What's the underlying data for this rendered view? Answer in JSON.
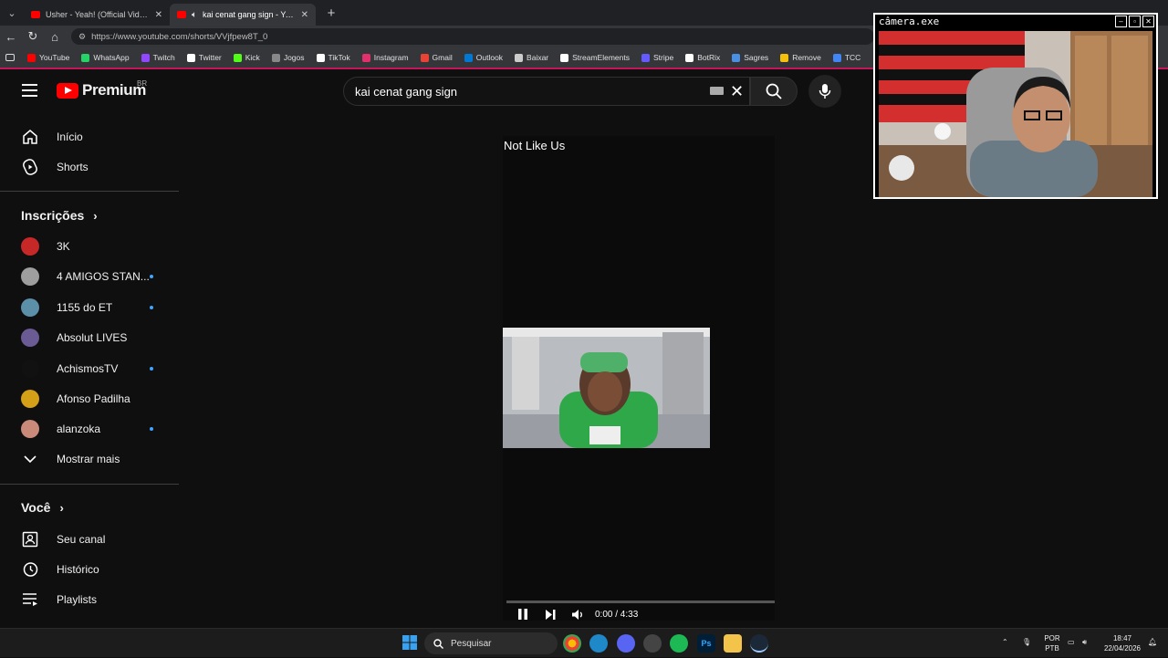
{
  "browser": {
    "tabs": [
      {
        "title": "Usher - Yeah! (Official Video) ft. Lil",
        "active": false
      },
      {
        "title": "kai cenat gang sign - YouTube",
        "active": true
      }
    ],
    "new_tab": "+",
    "url": "https://www.youtube.com/shorts/VVjfpew8T_0",
    "bookmarks": [
      "YouTube",
      "WhatsApp",
      "Twitch",
      "Twitter",
      "Kick",
      "Jogos",
      "TikTok",
      "Instagram",
      "Gmail",
      "Outlook",
      "Baixar",
      "StreamElements",
      "Stripe",
      "BotRix",
      "Sagres",
      "Remove",
      "TCC"
    ],
    "bookmark_colors": [
      "#ff0000",
      "#25d366",
      "#9146ff",
      "#ffffff",
      "#53fc18",
      "#888888",
      "#ffffff",
      "#e1306c",
      "#ea4335",
      "#0078d4",
      "#cccccc",
      "#ffffff",
      "#635bff",
      "#ffffff",
      "#4a90e2",
      "#f4c20d",
      "#4285f4"
    ]
  },
  "youtube": {
    "logo": "Premium",
    "logo_region": "BR",
    "search": {
      "value": "kai cenat gang sign"
    },
    "sidebar": {
      "main": [
        {
          "label": "Início",
          "icon": "home-icon"
        },
        {
          "label": "Shorts",
          "icon": "shorts-icon"
        }
      ],
      "subscriptions_header": "Inscrições",
      "subscriptions": [
        {
          "label": "3K",
          "dot": false,
          "color": "#c62828"
        },
        {
          "label": "4 AMIGOS STAN...",
          "dot": true,
          "color": "#9e9e9e"
        },
        {
          "label": "1155 do ET",
          "dot": true,
          "color": "#5c8fa8"
        },
        {
          "label": "Absolut LIVES",
          "dot": false,
          "color": "#6b5b95"
        },
        {
          "label": "AchismosTV",
          "dot": true,
          "color": "#111111"
        },
        {
          "label": "Afonso Padilha",
          "dot": false,
          "color": "#d4a017"
        },
        {
          "label": "alanzoka",
          "dot": true,
          "color": "#c98a7a"
        }
      ],
      "show_more": "Mostrar mais",
      "you_header": "Você",
      "you": [
        {
          "label": "Seu canal",
          "icon": "channel-icon"
        },
        {
          "label": "Histórico",
          "icon": "history-icon"
        },
        {
          "label": "Playlists",
          "icon": "playlists-icon"
        }
      ]
    },
    "video": {
      "title": "Not Like Us",
      "time": "0:00 / 4:33",
      "progress": 0
    }
  },
  "webcam": {
    "title": "câmera.exe"
  },
  "taskbar": {
    "search_placeholder": "Pesquisar",
    "lang_top": "POR",
    "lang_bottom": "PTB",
    "time": "18:47",
    "date": "22/04/2026"
  }
}
